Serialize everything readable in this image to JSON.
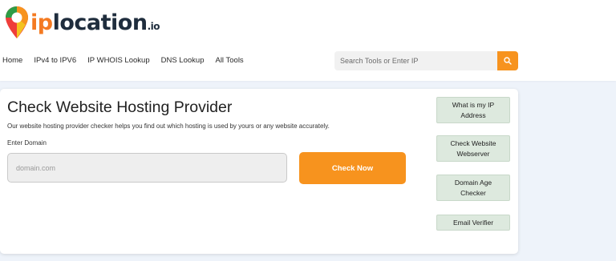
{
  "brand": {
    "ip": "ip",
    "location": "location",
    "tld": ".io",
    "icon": "map-pin-icon"
  },
  "nav": {
    "items": [
      {
        "label": "Home"
      },
      {
        "label": "IPv4 to IPV6"
      },
      {
        "label": "IP WHOIS Lookup"
      },
      {
        "label": "DNS Lookup"
      },
      {
        "label": "All Tools"
      }
    ]
  },
  "search": {
    "placeholder": "Search Tools or Enter IP",
    "icon": "search-icon"
  },
  "tool": {
    "title": "Check Website Hosting Provider",
    "description": "Our website hosting provider checker helps you find out which hosting is used by yours or any website accurately.",
    "field_label": "Enter Domain",
    "input_placeholder": "domain.com",
    "button_label": "Check Now"
  },
  "sidebar": {
    "links": [
      {
        "label": "What is my IP Address"
      },
      {
        "label": "Check Website Webserver"
      },
      {
        "label": "Domain Age Checker"
      },
      {
        "label": "Email Verifier"
      }
    ]
  },
  "colors": {
    "accent": "#f7931e",
    "brand_dark": "#1f2d3d",
    "side_button": "#dde9de",
    "background": "#eef3fa"
  }
}
